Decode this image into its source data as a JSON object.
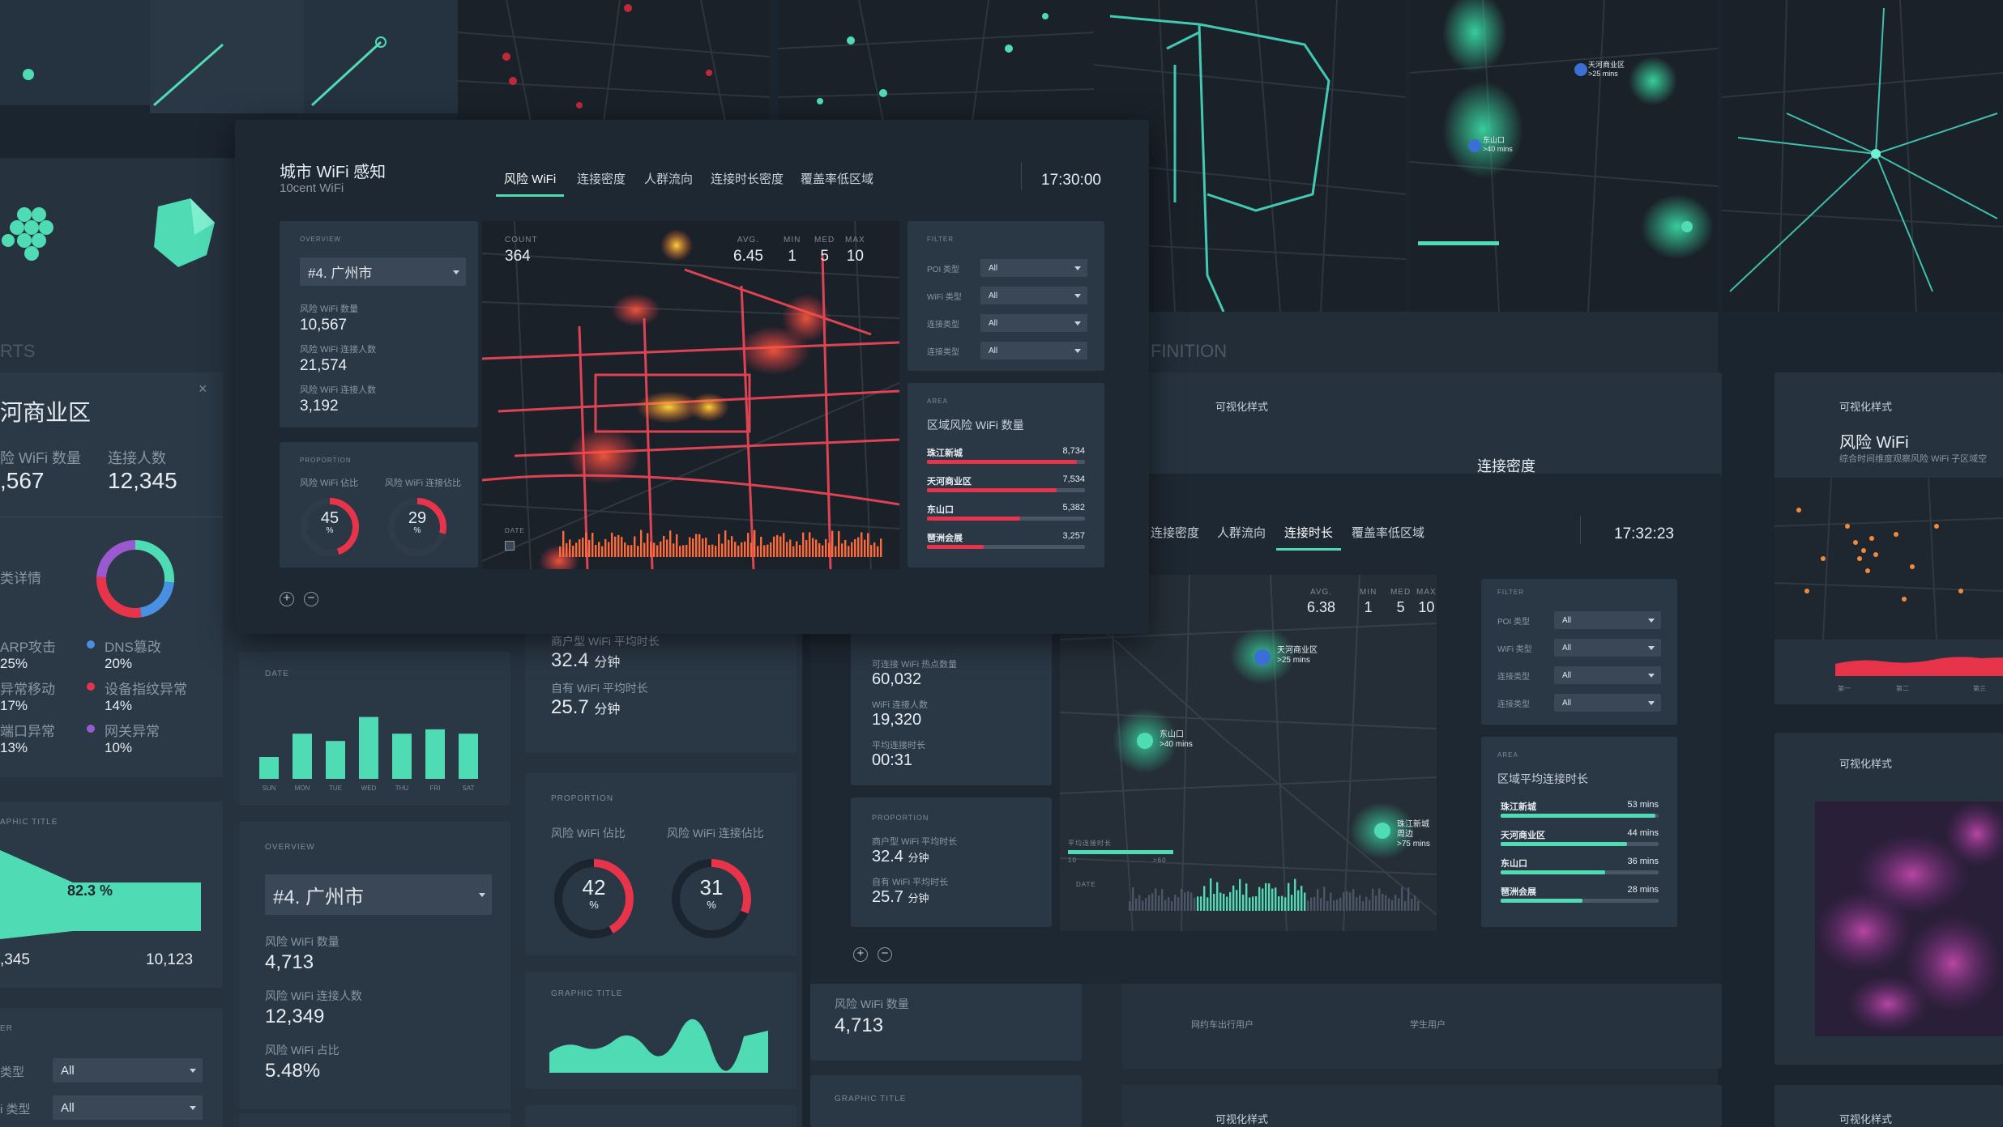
{
  "colors": {
    "accent": "#4fdcb5",
    "danger": "#e8344a",
    "bg": "#1b2530",
    "panel": "#2a3745"
  },
  "bg_left": {
    "section": "RTS",
    "district": "河商业区",
    "col1_label": "险 WiFi 数量",
    "col1_value": ",567",
    "col2_label": "连接人数",
    "col2_value": "12,345",
    "detail_label": "类详情",
    "close": "×",
    "legend": [
      {
        "name": "ARP攻击",
        "value": "25%",
        "color": "#e8344a"
      },
      {
        "name": "DNS篡改",
        "value": "20%",
        "color": "#4a90e2"
      },
      {
        "name": "异常移动",
        "value": "17%",
        "color": "#4fdcb5"
      },
      {
        "name": "设备指纹异常",
        "value": "14%",
        "color": "#e8344a"
      },
      {
        "name": "端口异常",
        "value": "13%",
        "color": "#4fdcb5"
      },
      {
        "name": "网关异常",
        "value": "10%",
        "color": "#9b59d0"
      }
    ],
    "graphic_title": "APHIC TITLE",
    "funnel_pct": "82.3 %",
    "funnel_left": ",345",
    "funnel_right": "10,123",
    "filter_label": "ER",
    "filter_rows": [
      {
        "label": "类型",
        "value": "All"
      },
      {
        "label": "i 类型",
        "value": "All"
      }
    ]
  },
  "bg_mid": {
    "date_label": "DATE",
    "weekdays": [
      "SUN",
      "MON",
      "TUE",
      "WED",
      "THU",
      "FRI",
      "SAT"
    ],
    "weekday_values": [
      30,
      62,
      52,
      85,
      62,
      68,
      62
    ],
    "overview_label": "OVERVIEW",
    "city": "#4. 广州市",
    "stats": [
      {
        "label": "风险 WiFi 数量",
        "value": "4,713"
      },
      {
        "label": "风险 WiFi 连接人数",
        "value": "12,349"
      },
      {
        "label": "风险 WiFi 占比",
        "value": "5.48%"
      }
    ],
    "avg_label_top": "商户型 WiFi 平均时长",
    "avg1_value": "32.4",
    "avg1_unit": "分钟",
    "avg2_label": "自有 WiFi 平均时长",
    "avg2_value": "25.7",
    "avg2_unit": "分钟",
    "proportion_label": "PROPORTION",
    "gauge1_label": "风险 WiFi 佔比",
    "gauge1_value": "42",
    "gauge2_label": "风险 WiFi 连接佔比",
    "gauge2_value": "31",
    "pct": "%",
    "graphic_title": "GRAPHIC TITLE"
  },
  "main_window": {
    "title": "城市 WiFi 感知",
    "subtitle": "10cent WiFi",
    "tabs": [
      "风险 WiFi",
      "连接密度",
      "人群流向",
      "连接时长密度",
      "覆盖率低区域"
    ],
    "active_tab": 0,
    "time": "17:30:00",
    "overview_label": "OVERVIEW",
    "city": "#4. 广州市",
    "stats": [
      {
        "label": "风险 WiFi 数量",
        "value": "10,567"
      },
      {
        "label": "风险 WiFi 连接人数",
        "value": "21,574"
      },
      {
        "label": "风险 WiFi 连接人数",
        "value": "3,192"
      }
    ],
    "proportion_label": "PROPORTION",
    "gauge1_label": "风险 WiFi 佔比",
    "gauge1_value": "45",
    "gauge2_label": "风险 WiFi 连接佔比",
    "gauge2_value": "29",
    "pct": "%",
    "map_metrics": [
      {
        "label": "COUNT",
        "value": "364"
      },
      {
        "label": "AVG.",
        "value": "6.45"
      },
      {
        "label": "MIN",
        "value": "1"
      },
      {
        "label": "MED",
        "value": "5"
      },
      {
        "label": "MAX",
        "value": "10"
      }
    ],
    "date_label": "DATE",
    "filter_label": "FILTER",
    "filters": [
      {
        "label": "POI 类型",
        "value": "All"
      },
      {
        "label": "WiFi 类型",
        "value": "All"
      },
      {
        "label": "连接类型",
        "value": "All"
      },
      {
        "label": "连接类型",
        "value": "All"
      }
    ],
    "area_label": "AREA",
    "area_title": "区域风险 WiFi 数量",
    "area_rows": [
      {
        "name": "珠江新城",
        "value": "8,734",
        "fraction": 0.95
      },
      {
        "name": "天河商业区",
        "value": "7,534",
        "fraction": 0.82
      },
      {
        "name": "东山口",
        "value": "5,382",
        "fraction": 0.59
      },
      {
        "name": "琶洲会展",
        "value": "3,257",
        "fraction": 0.36
      }
    ]
  },
  "second_window": {
    "tabs": [
      "连接密度",
      "人群流向",
      "连接时长",
      "覆盖率低区域"
    ],
    "active_tab": 2,
    "time": "17:32:23",
    "top_title": "连接密度",
    "viz_label": "可视化样式",
    "stats": [
      {
        "label": "可连接 WiFi 热点数量",
        "value": "60,032"
      },
      {
        "label": "WiFi 连接人数",
        "value": "19,320"
      },
      {
        "label": "平均连接时长",
        "value": "00:31"
      }
    ],
    "proportion_label": "PROPORTION",
    "avg1_label": "商户型 WiFi 平均时长",
    "avg1_value": "32.4",
    "avg1_unit": "分钟",
    "avg2_label": "自有 WiFi 平均时长",
    "avg2_value": "25.7",
    "avg2_unit": "分钟",
    "map_metrics": [
      {
        "label": "AVG.",
        "value": "6.38"
      },
      {
        "label": "MIN",
        "value": "1"
      },
      {
        "label": "MED",
        "value": "5"
      },
      {
        "label": "MAX",
        "value": "10"
      }
    ],
    "pins": [
      {
        "name": "天河商业区",
        "sub": ">25 mins"
      },
      {
        "name": "东山口",
        "sub": ">40 mins"
      },
      {
        "name": "珠江新城周边",
        "sub": ">75 mins"
      }
    ],
    "legend_label": "平均连接时长",
    "legend_min": "10",
    "legend_max": ">60",
    "date_label": "DATE",
    "filter_label": "FILTER",
    "filters": [
      {
        "label": "POI 类型",
        "value": "All"
      },
      {
        "label": "WiFi 类型",
        "value": "All"
      },
      {
        "label": "连接类型",
        "value": "All"
      },
      {
        "label": "连接类型",
        "value": "All"
      }
    ],
    "area_label": "AREA",
    "area_title": "区域平均连接时长",
    "area_rows": [
      {
        "name": "珠江新城",
        "value": "53 mins",
        "fraction": 0.98
      },
      {
        "name": "天河商业区",
        "value": "44 mins",
        "fraction": 0.8
      },
      {
        "name": "东山口",
        "value": "36 mins",
        "fraction": 0.66
      },
      {
        "name": "琶洲会展",
        "value": "28 mins",
        "fraction": 0.52
      }
    ],
    "bottom_stat_label": "风险 WiFi 数量",
    "bottom_stat_value": "4,713",
    "bottom_graphic": "GRAPHIC TITLE",
    "under_labels": [
      "网约车出行用户",
      "学生用户"
    ]
  },
  "bg_right": {
    "section": "FINITION",
    "viz_label": "可视化样式",
    "risk_title": "风险 WiFi",
    "risk_desc": "综合时间维度观察风险 WiFi 子区域空",
    "tick1": "第一",
    "tick2": "第二",
    "tick3": "第三",
    "viz_label_bottom": "可视化样式",
    "top_pins": [
      {
        "name": "天河商业区",
        "sub": ">25 mins"
      },
      {
        "name": "东山口",
        "sub": ">40 mins"
      }
    ]
  }
}
